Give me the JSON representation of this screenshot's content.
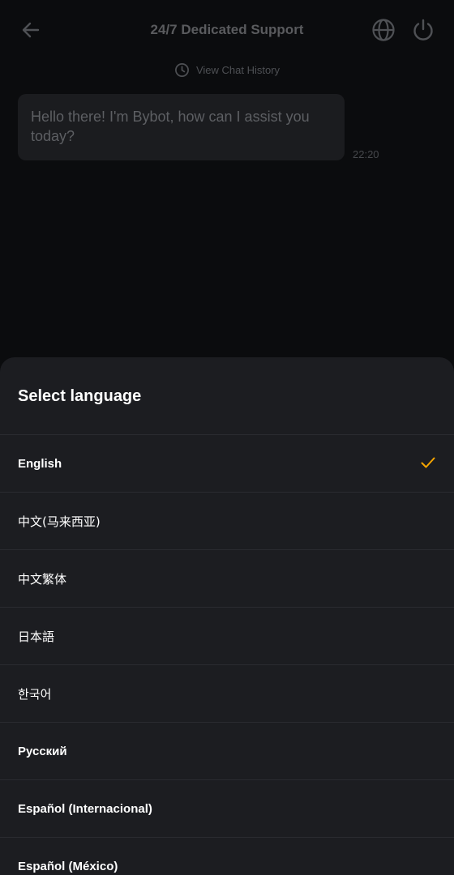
{
  "header": {
    "title": "24/7 Dedicated Support",
    "history_label": "View Chat History"
  },
  "chat": {
    "messages": [
      {
        "text": "Hello there! I'm Bybot, how can I assist you today?",
        "time": "22:20"
      }
    ]
  },
  "sheet": {
    "title": "Select language",
    "selected": "English",
    "accent_color": "#f7a600",
    "languages": [
      {
        "label": "English"
      },
      {
        "label": "中文(马来西亚)"
      },
      {
        "label": "中文繁体"
      },
      {
        "label": "日本語"
      },
      {
        "label": "한국어"
      },
      {
        "label": "Русский"
      },
      {
        "label": "Español (Internacional)"
      },
      {
        "label": "Español (México)"
      }
    ]
  },
  "icons": {
    "back": "arrow-left-icon",
    "language": "globe-icon",
    "end_chat": "power-icon",
    "history": "clock-icon",
    "selected": "check-icon"
  }
}
